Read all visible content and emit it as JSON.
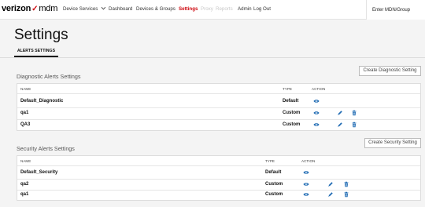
{
  "header": {
    "brand": "verizon",
    "product": "mdm",
    "nav": [
      "Device Services",
      "Dashboard",
      "Devices & Groups",
      "Settings",
      "Proxy",
      "Reports",
      "Admin",
      "Log Out"
    ],
    "mdn_label": "Enter MDN/Group"
  },
  "page": {
    "title": "Settings",
    "tab": "ALERTS SETTINGS"
  },
  "diagnostic": {
    "title": "Diagnostic Alerts Settings",
    "button": "Create Diagnostic Setting",
    "columns": [
      "NAME",
      "TYPE",
      "ACTION"
    ],
    "rows": [
      {
        "name": "Default_Diagnostic",
        "type": "Default",
        "actions": [
          "view"
        ]
      },
      {
        "name": "qa1",
        "type": "Custom",
        "actions": [
          "view",
          "edit",
          "delete"
        ]
      },
      {
        "name": "QA3",
        "type": "Custom",
        "actions": [
          "view",
          "edit",
          "delete"
        ]
      }
    ]
  },
  "security": {
    "title": "Security Alerts Settings",
    "button": "Create Security Setting",
    "columns": [
      "NAME",
      "TYPE",
      "ACTION"
    ],
    "rows": [
      {
        "name": "Default_Security",
        "type": "Default",
        "actions": [
          "view"
        ]
      },
      {
        "name": "qa2",
        "type": "Custom",
        "actions": [
          "view",
          "edit",
          "delete"
        ]
      },
      {
        "name": "qa1",
        "type": "Custom",
        "actions": [
          "view",
          "edit",
          "delete"
        ]
      }
    ]
  },
  "colors": {
    "accent_red": "#cd040b",
    "icon_blue": "#1f6bb3",
    "disabled_nav": "#c8c8c8"
  }
}
